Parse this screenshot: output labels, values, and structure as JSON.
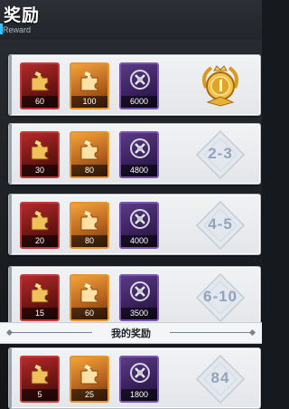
{
  "header": {
    "title": "奖励",
    "subtitle": "Reward"
  },
  "icons": {
    "red": "red-puzzle-piece-icon",
    "orange": "orange-puzzle-piece-icon",
    "purple": "purple-wreath-emblem-icon",
    "gold": "gold-crown-medal-icon",
    "rank_frame": "silver-diamond-frame-icon"
  },
  "colors": {
    "accent": "#37c2ff",
    "card_bg": "#eceef1",
    "rank_text": "#8fa4bb",
    "red_frame": "#c33a3a",
    "orange_frame": "#e5942e",
    "purple_frame": "#7a55b0"
  },
  "rewards": [
    {
      "rank_label": "",
      "rank_type": "gold-medal",
      "items": [
        "60",
        "100",
        "6000"
      ]
    },
    {
      "rank_label": "2-3",
      "rank_type": "range",
      "items": [
        "30",
        "80",
        "4800"
      ]
    },
    {
      "rank_label": "4-5",
      "rank_type": "range",
      "items": [
        "20",
        "80",
        "4000"
      ]
    },
    {
      "rank_label": "6-10",
      "rank_type": "range",
      "items": [
        "15",
        "60",
        "3500"
      ]
    }
  ],
  "my_reward": {
    "section_label": "我的奖励",
    "rank_label": "84",
    "items": [
      "5",
      "25",
      "1800"
    ]
  }
}
